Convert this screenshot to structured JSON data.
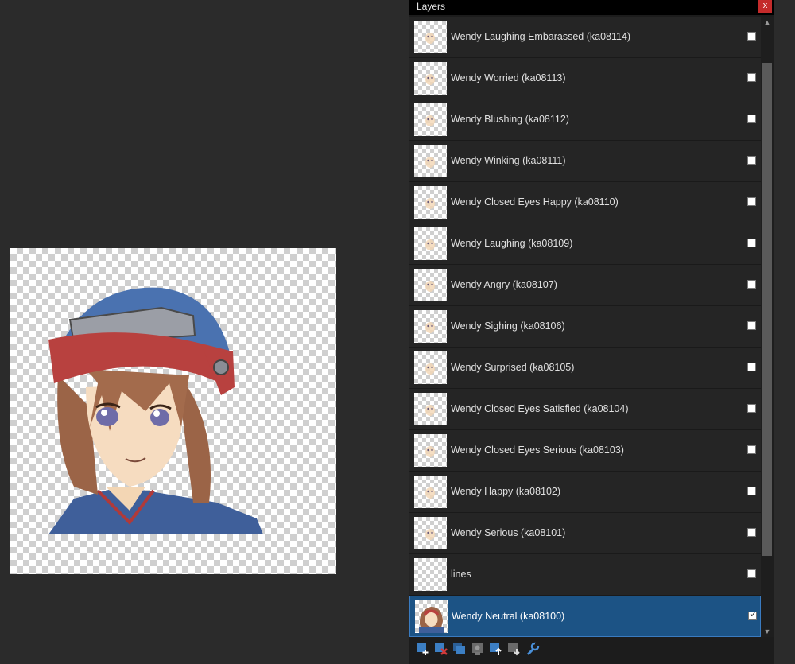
{
  "window": {
    "title": "Layers",
    "close_label": "x"
  },
  "canvas": {
    "content": "character-portrait"
  },
  "layers": [
    {
      "label": "Wendy Laughing Embarassed (ka08114)",
      "visible": false,
      "selected": false
    },
    {
      "label": "Wendy Worried (ka08113)",
      "visible": false,
      "selected": false
    },
    {
      "label": "Wendy Blushing (ka08112)",
      "visible": false,
      "selected": false
    },
    {
      "label": "Wendy Winking (ka08111)",
      "visible": false,
      "selected": false
    },
    {
      "label": "Wendy Closed Eyes Happy (ka08110)",
      "visible": false,
      "selected": false
    },
    {
      "label": "Wendy Laughing (ka08109)",
      "visible": false,
      "selected": false
    },
    {
      "label": "Wendy Angry (ka08107)",
      "visible": false,
      "selected": false
    },
    {
      "label": "Wendy Sighing (ka08106)",
      "visible": false,
      "selected": false
    },
    {
      "label": "Wendy Surprised (ka08105)",
      "visible": false,
      "selected": false
    },
    {
      "label": "Wendy Closed Eyes Satisfied (ka08104)",
      "visible": false,
      "selected": false
    },
    {
      "label": "Wendy Closed Eyes Serious (ka08103)",
      "visible": false,
      "selected": false
    },
    {
      "label": "Wendy Happy (ka08102)",
      "visible": false,
      "selected": false
    },
    {
      "label": "Wendy Serious (ka08101)",
      "visible": false,
      "selected": false
    },
    {
      "label": "lines",
      "visible": false,
      "selected": false
    },
    {
      "label": "Wendy Neutral (ka08100)",
      "visible": true,
      "selected": true
    }
  ],
  "toolbar": {
    "tools": [
      {
        "icon": "add-layer-icon"
      },
      {
        "icon": "delete-layer-icon"
      },
      {
        "icon": "duplicate-layer-icon"
      },
      {
        "icon": "merge-layer-icon"
      },
      {
        "icon": "move-layer-up-icon"
      },
      {
        "icon": "move-layer-down-icon"
      },
      {
        "icon": "layer-properties-icon"
      }
    ]
  },
  "colors": {
    "background": "#2b2b2b",
    "panel": "#1c1c1c",
    "row": "#252525",
    "selected_row": "#1c5385",
    "close_button": "#c42b2b"
  }
}
